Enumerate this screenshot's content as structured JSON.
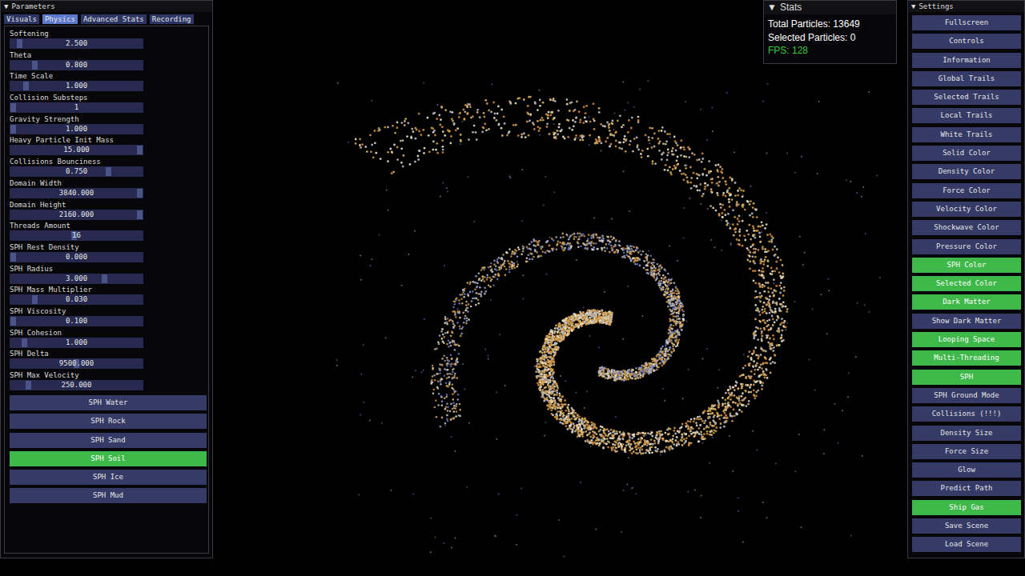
{
  "parameters": {
    "toggle": "▼",
    "title": "Parameters",
    "tabs": [
      {
        "label": "Visuals",
        "selected": false
      },
      {
        "label": "Physics",
        "selected": true
      },
      {
        "label": "Advanced Stats",
        "selected": false
      },
      {
        "label": "Recording",
        "selected": false
      }
    ],
    "sliders": [
      {
        "label": "Softening",
        "value": "2.500",
        "level": 0.05
      },
      {
        "label": "Theta",
        "value": "0.800",
        "level": 0.17
      },
      {
        "label": "Time Scale",
        "value": "1.000",
        "level": 0.1
      },
      {
        "label": "Collision Substeps",
        "value": "1",
        "level": 0.0
      },
      {
        "label": "Gravity Strength",
        "value": "1.000",
        "level": 0.0
      },
      {
        "label": "Heavy Particle Init Mass",
        "value": "15.000",
        "level": 1.0
      },
      {
        "label": "Collisions Bounciness",
        "value": "0.750",
        "level": 0.75
      },
      {
        "label": "Domain Width",
        "value": "3840.000",
        "level": 1.0
      },
      {
        "label": "Domain Height",
        "value": "2160.000",
        "level": 1.0
      },
      {
        "label": "Threads Amount",
        "value": "16",
        "level": 0.48
      },
      {
        "label": "SPH Rest Density",
        "value": "0.000",
        "level": 0.0
      },
      {
        "label": "SPH Radius",
        "value": "3.000",
        "level": 0.72
      },
      {
        "label": "SPH Mass Multiplier",
        "value": "0.030",
        "level": 0.17
      },
      {
        "label": "SPH Viscosity",
        "value": "0.100",
        "level": 0.0
      },
      {
        "label": "SPH Cohesion",
        "value": "1.000",
        "level": 0.09
      },
      {
        "label": "SPH Delta",
        "value": "9500.000",
        "level": 0.5
      },
      {
        "label": "SPH Max Velocity",
        "value": "250.000",
        "level": 0.12
      }
    ],
    "presets": [
      {
        "label": "SPH Water",
        "selected": false
      },
      {
        "label": "SPH Rock",
        "selected": false
      },
      {
        "label": "SPH Sand",
        "selected": false
      },
      {
        "label": "SPH Soil",
        "selected": true
      },
      {
        "label": "SPH Ice",
        "selected": false
      },
      {
        "label": "SPH Mud",
        "selected": false
      }
    ]
  },
  "stats": {
    "toggle": "▼",
    "title": "Stats",
    "lines": [
      {
        "text": "Total Particles: 13649",
        "color": "#ffffff"
      },
      {
        "text": "Selected Particles: 0",
        "color": "#ffffff"
      },
      {
        "text": "FPS: 128",
        "color": "#3cc83c"
      }
    ]
  },
  "settings": {
    "toggle": "▼",
    "title": "Settings",
    "buttons": [
      {
        "label": "Fullscreen",
        "on": false
      },
      {
        "label": "Controls",
        "on": false
      },
      {
        "label": "Information",
        "on": false
      },
      {
        "label": "Global Trails",
        "on": false
      },
      {
        "label": "Selected Trails",
        "on": false
      },
      {
        "label": "Local Trails",
        "on": false
      },
      {
        "label": "White Trails",
        "on": false
      },
      {
        "label": "Solid Color",
        "on": false
      },
      {
        "label": "Density Color",
        "on": false
      },
      {
        "label": "Force Color",
        "on": false
      },
      {
        "label": "Velocity Color",
        "on": false
      },
      {
        "label": "Shockwave Color",
        "on": false
      },
      {
        "label": "Pressure Color",
        "on": false
      },
      {
        "label": "SPH Color",
        "on": true
      },
      {
        "label": "Selected Color",
        "on": true
      },
      {
        "label": "Dark Matter",
        "on": true
      },
      {
        "label": "Show Dark Matter",
        "on": false
      },
      {
        "label": "Looping Space",
        "on": true
      },
      {
        "label": "Multi-Threading",
        "on": true
      },
      {
        "label": "SPH",
        "on": true
      },
      {
        "label": "SPH Ground Mode",
        "on": false
      },
      {
        "label": "Collisions (!!!)",
        "on": false
      },
      {
        "label": "Density Size",
        "on": false
      },
      {
        "label": "Force Size",
        "on": false
      },
      {
        "label": "Glow",
        "on": false
      },
      {
        "label": "Predict Path",
        "on": false
      },
      {
        "label": "Ship Gas",
        "on": true
      },
      {
        "label": "Save Scene",
        "on": false
      },
      {
        "label": "Load Scene",
        "on": false
      }
    ]
  }
}
